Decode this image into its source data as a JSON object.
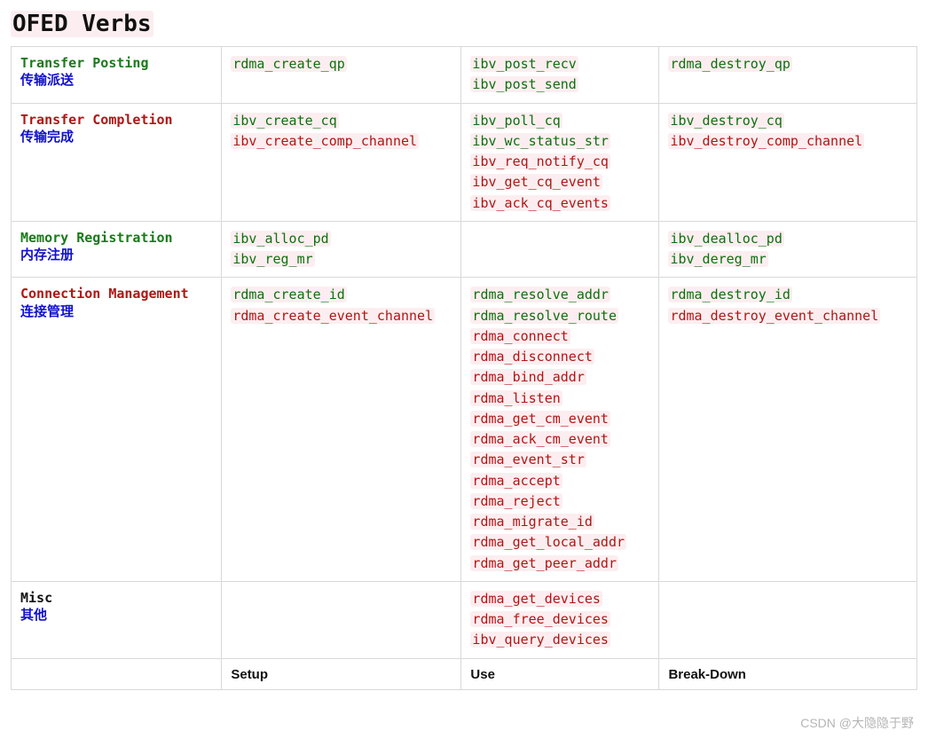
{
  "title": "OFED Verbs",
  "footer": {
    "setup": "Setup",
    "use": "Use",
    "breakdown": "Break-Down"
  },
  "rows": [
    {
      "en": "Transfer Posting",
      "cn": "传输派送",
      "color": "green",
      "setup": [
        {
          "t": "rdma_create_qp",
          "c": "green"
        }
      ],
      "use": [
        {
          "t": "ibv_post_recv",
          "c": "green"
        },
        {
          "t": "ibv_post_send",
          "c": "green"
        }
      ],
      "break": [
        {
          "t": "rdma_destroy_qp",
          "c": "green"
        }
      ]
    },
    {
      "en": "Transfer Completion",
      "cn": "传输完成",
      "color": "red",
      "setup": [
        {
          "t": "ibv_create_cq",
          "c": "green"
        },
        {
          "t": "ibv_create_comp_channel",
          "c": "red"
        }
      ],
      "use": [
        {
          "t": "ibv_poll_cq",
          "c": "green"
        },
        {
          "t": "ibv_wc_status_str",
          "c": "green"
        },
        {
          "t": "ibv_req_notify_cq",
          "c": "red"
        },
        {
          "t": "ibv_get_cq_event",
          "c": "red"
        },
        {
          "t": "ibv_ack_cq_events",
          "c": "red"
        }
      ],
      "break": [
        {
          "t": "ibv_destroy_cq",
          "c": "green"
        },
        {
          "t": "ibv_destroy_comp_channel",
          "c": "red"
        }
      ]
    },
    {
      "en": "Memory Registration",
      "cn": "内存注册",
      "color": "green",
      "setup": [
        {
          "t": "ibv_alloc_pd",
          "c": "green"
        },
        {
          "t": "ibv_reg_mr",
          "c": "green"
        }
      ],
      "use": [],
      "break": [
        {
          "t": "ibv_dealloc_pd",
          "c": "green"
        },
        {
          "t": "ibv_dereg_mr",
          "c": "green"
        }
      ]
    },
    {
      "en": "Connection Management",
      "cn": "连接管理",
      "color": "red",
      "setup": [
        {
          "t": "rdma_create_id",
          "c": "green"
        },
        {
          "t": "rdma_create_event_channel",
          "c": "red"
        }
      ],
      "use": [
        {
          "t": "rdma_resolve_addr",
          "c": "green"
        },
        {
          "t": "rdma_resolve_route",
          "c": "green"
        },
        {
          "t": "rdma_connect",
          "c": "red"
        },
        {
          "t": "rdma_disconnect",
          "c": "red"
        },
        {
          "t": "rdma_bind_addr",
          "c": "red"
        },
        {
          "t": "rdma_listen",
          "c": "red"
        },
        {
          "t": "rdma_get_cm_event",
          "c": "red"
        },
        {
          "t": "rdma_ack_cm_event",
          "c": "red"
        },
        {
          "t": "rdma_event_str",
          "c": "red"
        },
        {
          "t": "rdma_accept",
          "c": "red"
        },
        {
          "t": "rdma_reject",
          "c": "red"
        },
        {
          "t": "rdma_migrate_id",
          "c": "red"
        },
        {
          "t": "rdma_get_local_addr",
          "c": "red"
        },
        {
          "t": "rdma_get_peer_addr",
          "c": "red"
        }
      ],
      "break": [
        {
          "t": "rdma_destroy_id",
          "c": "green"
        },
        {
          "t": "rdma_destroy_event_channel",
          "c": "red"
        }
      ]
    },
    {
      "en": "Misc",
      "cn": "其他",
      "color": "black",
      "setup": [],
      "use": [
        {
          "t": "rdma_get_devices",
          "c": "red"
        },
        {
          "t": "rdma_free_devices",
          "c": "red"
        },
        {
          "t": "ibv_query_devices",
          "c": "red"
        }
      ],
      "break": []
    }
  ],
  "watermark": "CSDN @大隐隐于野"
}
